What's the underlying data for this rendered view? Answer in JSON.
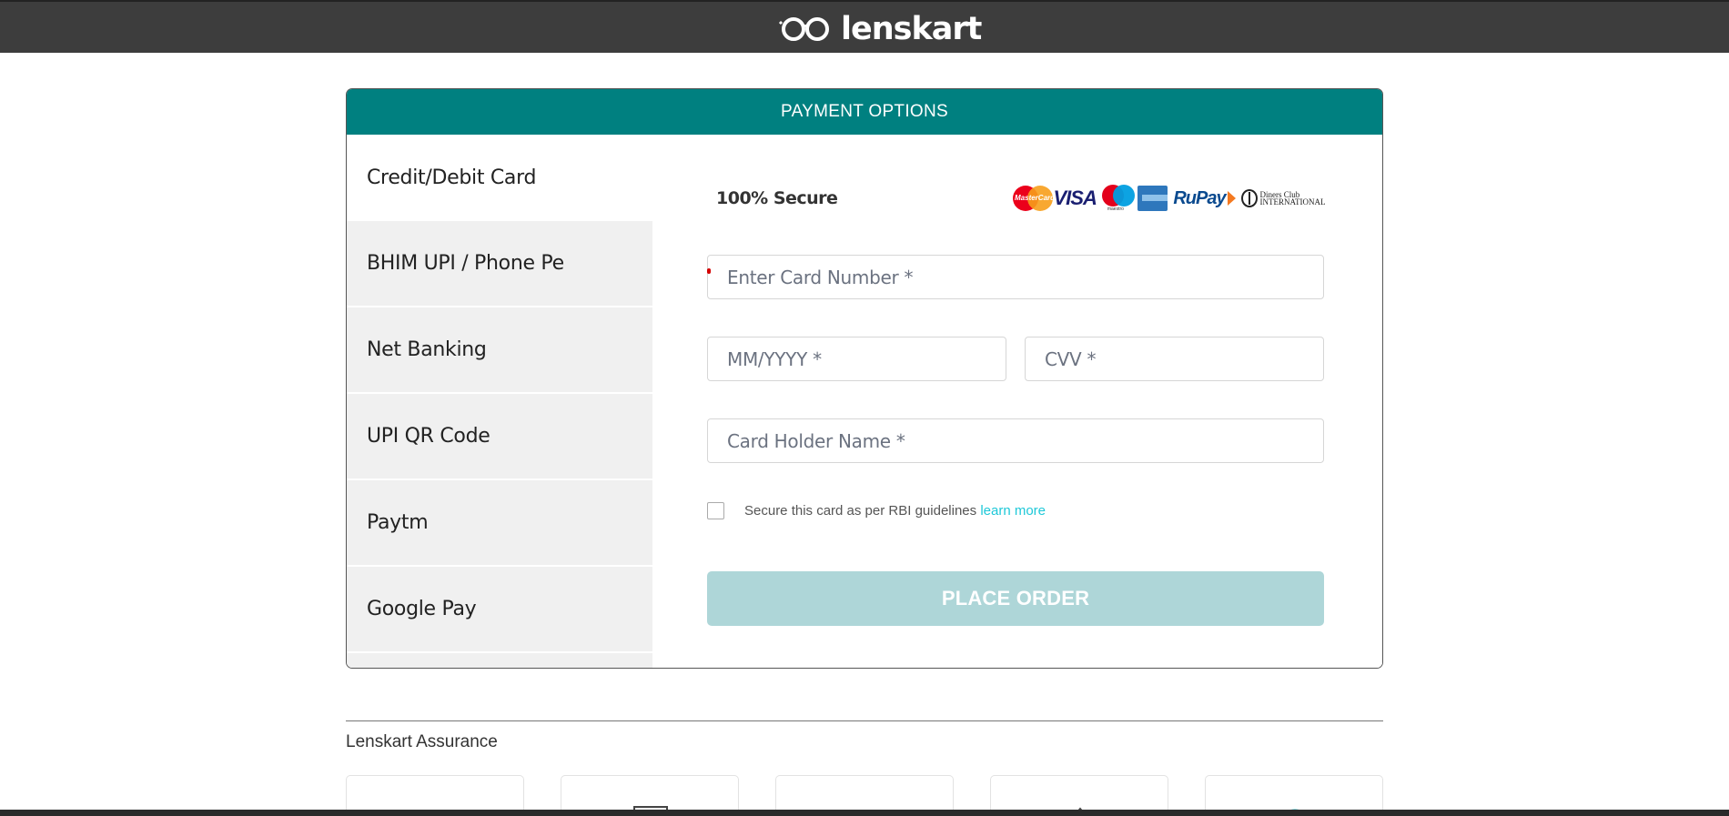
{
  "header": {
    "logo_text": "lenskart"
  },
  "payment": {
    "title": "PAYMENT OPTIONS",
    "tabs": [
      {
        "label": "Credit/Debit Card"
      },
      {
        "label": "BHIM UPI / Phone Pe"
      },
      {
        "label": "Net Banking"
      },
      {
        "label": "UPI QR Code"
      },
      {
        "label": "Paytm"
      },
      {
        "label": "Google Pay"
      }
    ],
    "secure_label": "100% Secure",
    "card_logos": {
      "mastercard": "MasterCard",
      "visa": "VISA",
      "maestro": "maestro",
      "rupay": "RuPay",
      "diners": "Diners Club INTERNATIONAL"
    },
    "card_number_placeholder": "Enter Card Number *",
    "expiry_placeholder": "MM/YYYY *",
    "cvv_placeholder": "CVV *",
    "holder_placeholder": "Card Holder Name *",
    "save_card_text": "Secure this card as per RBI guidelines",
    "learn_more": "learn more",
    "place_order": "PLACE ORDER"
  },
  "assurance": {
    "title": "Lenskart Assurance"
  },
  "colors": {
    "header_bg": "#3d3d3d",
    "teal": "#008080",
    "place_order_bg": "#aed6d8",
    "tab_bg": "#f0f0f0",
    "link": "#1ec8d8"
  }
}
